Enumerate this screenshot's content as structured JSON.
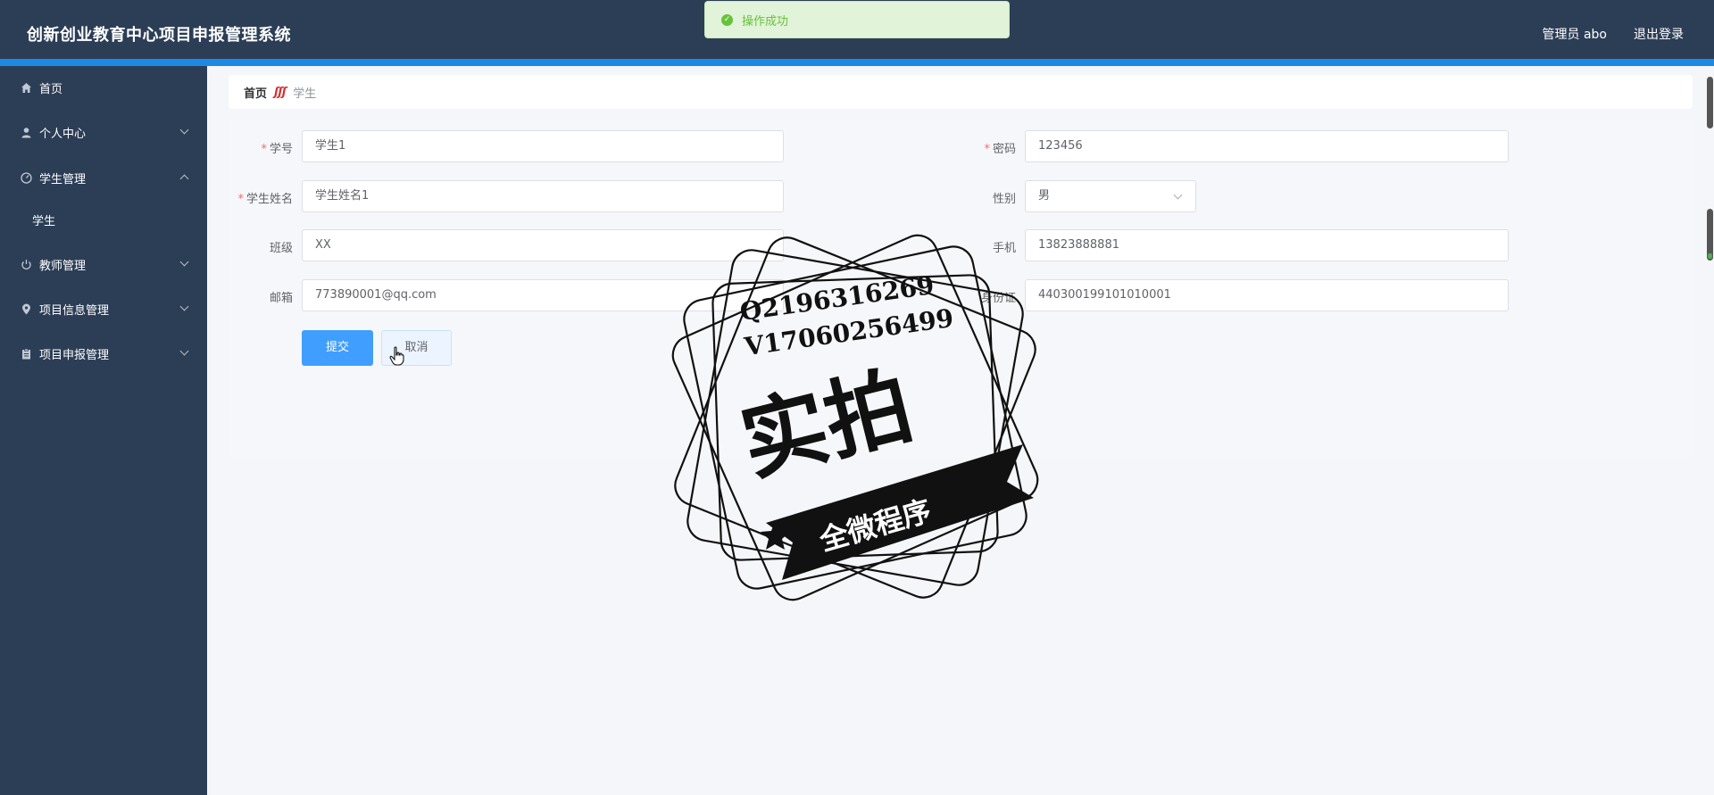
{
  "header": {
    "app_title": "创新创业教育中心项目申报管理系统",
    "user_info": "管理员 abo",
    "logout": "退出登录"
  },
  "toast": {
    "message": "操作成功"
  },
  "sidebar": {
    "items": [
      {
        "label": "首页",
        "icon": "home-icon"
      },
      {
        "label": "个人中心",
        "icon": "user-icon"
      },
      {
        "label": "学生管理",
        "icon": "dashboard-icon"
      },
      {
        "label": "学生",
        "icon": ""
      },
      {
        "label": "教师管理",
        "icon": "power-icon"
      },
      {
        "label": "项目信息管理",
        "icon": "location-icon"
      },
      {
        "label": "项目申报管理",
        "icon": "clipboard-icon"
      }
    ]
  },
  "breadcrumb": {
    "home": "首页",
    "separator": "ʃʃʃ",
    "current": "学生"
  },
  "form": {
    "student_id": {
      "label": "学号",
      "value": "学生1"
    },
    "password": {
      "label": "密码",
      "value": "123456"
    },
    "student_name": {
      "label": "学生姓名",
      "value": "学生姓名1"
    },
    "gender": {
      "label": "性别",
      "value": "男"
    },
    "class": {
      "label": "班级",
      "value": "XX"
    },
    "phone": {
      "label": "手机",
      "value": "13823888881"
    },
    "email": {
      "label": "邮箱",
      "value": "773890001@qq.com"
    },
    "id_card": {
      "label": "身份证",
      "value": "440300199101010001"
    },
    "submit": "提交",
    "cancel": "取消"
  },
  "watermark": {
    "line1": "Q2196316269",
    "line2": "V17060256499",
    "big": "实拍",
    "ribbon": "全微程序"
  },
  "colors": {
    "header_bg": "#2c3e56",
    "accent": "#1e88e5",
    "primary_button": "#409eff",
    "required": "#f56c6c",
    "success": "#67c23a"
  }
}
